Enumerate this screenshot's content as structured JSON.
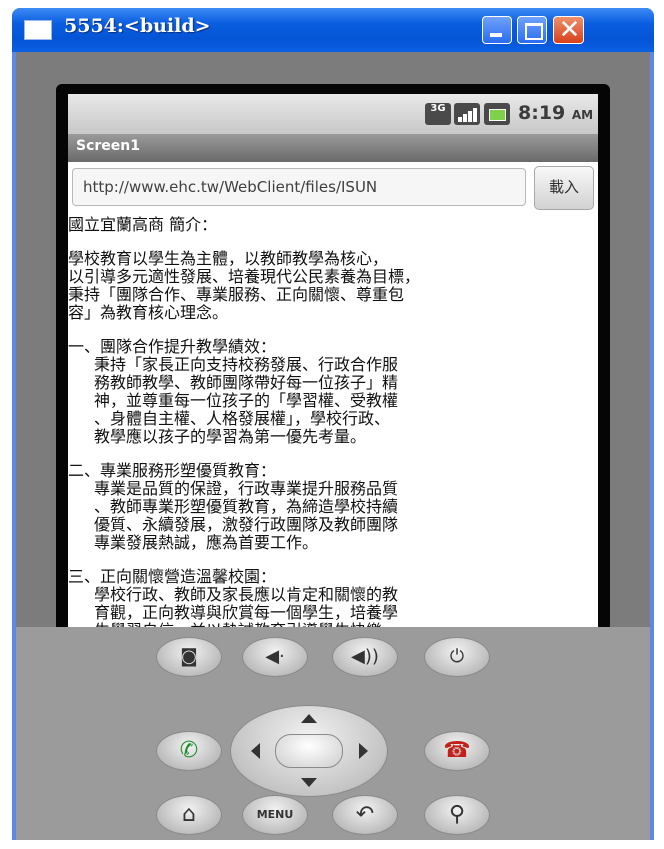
{
  "window": {
    "title": "5554:<build>",
    "close_glyph": "✕"
  },
  "statusbar": {
    "network": "3G",
    "time": "8:19",
    "ampm": "AM"
  },
  "app": {
    "title": "Screen1"
  },
  "url_bar": {
    "value": "http://www.ehc.tw/WebClient/files/ISUN",
    "load_label": "載入"
  },
  "content": {
    "lines": [
      {
        "text": "國立宜蘭高商 簡介：",
        "indent": false
      },
      {
        "text": "",
        "gap": true
      },
      {
        "text": "學校教育以學生為主體，以教師教學為核心，",
        "indent": false
      },
      {
        "text": "以引導多元適性發展、培養現代公民素養為目標，",
        "indent": false
      },
      {
        "text": "秉持「團隊合作、專業服務、正向關懷、尊重包",
        "indent": false
      },
      {
        "text": "容」為教育核心理念。",
        "indent": false
      },
      {
        "text": "",
        "gap": true
      },
      {
        "text": "一、團隊合作提升教學績效：",
        "indent": false
      },
      {
        "text": "秉持「家長正向支持校務發展、行政合作服",
        "indent": true
      },
      {
        "text": "務教師教學、教師團隊帶好每一位孩子」精",
        "indent": true
      },
      {
        "text": "神，並尊重每一位孩子的「學習權、受教權",
        "indent": true
      },
      {
        "text": "、身體自主權、人格發展權」，學校行政、",
        "indent": true
      },
      {
        "text": "教學應以孩子的學習為第一優先考量。",
        "indent": true
      },
      {
        "text": "",
        "gap": true
      },
      {
        "text": "二、專業服務形塑優質教育：",
        "indent": false
      },
      {
        "text": "專業是品質的保證，行政專業提升服務品質",
        "indent": true
      },
      {
        "text": "、教師專業形塑優質教育，為締造學校持續",
        "indent": true
      },
      {
        "text": "優質、永續發展，激發行政團隊及教師團隊",
        "indent": true
      },
      {
        "text": "專業發展熱誠，應為首要工作。",
        "indent": true
      },
      {
        "text": "",
        "gap": true
      },
      {
        "text": "三、正向關懷營造溫馨校園：",
        "indent": false
      },
      {
        "text": "學校行政、教師及家長應以肯定和關懷的教",
        "indent": true
      },
      {
        "text": "育觀，正向教導與欣賞每一個學生，培養學",
        "indent": true
      },
      {
        "text": "生學習自信，並以熱誠教育引導學生快樂",
        "indent": true
      }
    ]
  },
  "hardware": {
    "menu_label": "MENU",
    "buttons": [
      {
        "name": "camera-button",
        "icon": "camera-icon",
        "glyph": "◙"
      },
      {
        "name": "volume-down-button",
        "icon": "volume-down-icon",
        "glyph": "◀·"
      },
      {
        "name": "volume-up-button",
        "icon": "volume-up-icon",
        "glyph": "◀))"
      },
      {
        "name": "power-button",
        "icon": "power-icon",
        "glyph": "⏻"
      },
      {
        "name": "call-button",
        "icon": "phone-call-icon",
        "glyph": "✆"
      },
      {
        "name": "end-call-button",
        "icon": "phone-end-icon",
        "glyph": "☎"
      },
      {
        "name": "home-button",
        "icon": "home-icon",
        "glyph": "⌂"
      },
      {
        "name": "back-button",
        "icon": "back-icon",
        "glyph": "↶"
      },
      {
        "name": "search-button",
        "icon": "search-icon",
        "glyph": "⚲"
      }
    ]
  }
}
